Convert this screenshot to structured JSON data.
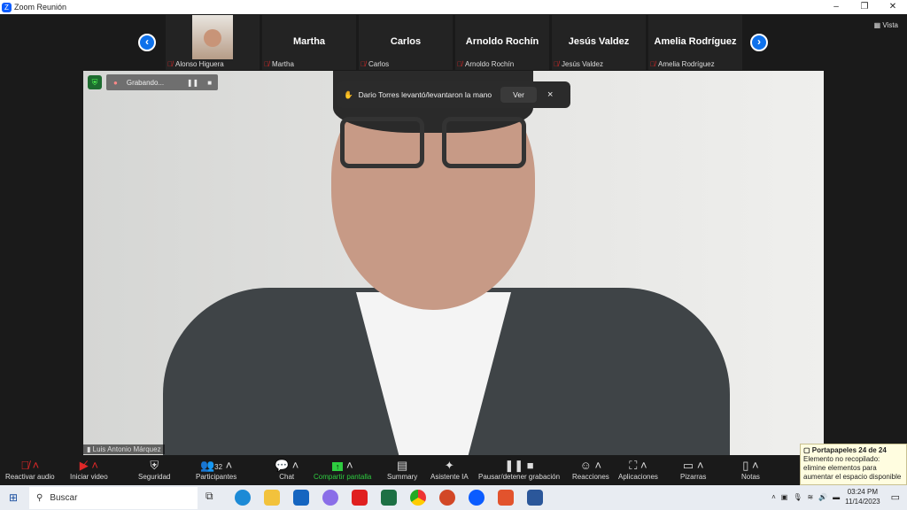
{
  "window": {
    "title": "Zoom Reunión",
    "minimize": "–",
    "restore": "❐",
    "close": "✕"
  },
  "strip": {
    "view_label": "Vista",
    "prev": "‹",
    "next": "›",
    "tiles": [
      {
        "name": "",
        "label": "Alonso Higuera"
      },
      {
        "name": "Martha",
        "label": "Martha"
      },
      {
        "name": "Carlos",
        "label": "Carlos"
      },
      {
        "name": "Arnoldo Rochín",
        "label": "Arnoldo Rochín"
      },
      {
        "name": "Jesús Valdez",
        "label": "Jesús Valdez"
      },
      {
        "name": "Amelia Rodríguez",
        "label": "Amelia Rodríguez"
      }
    ]
  },
  "recording": {
    "label": "Grabando..."
  },
  "notification": {
    "text": "Dario Torres levantó/levantaron la mano",
    "view": "Ver",
    "close": "×"
  },
  "speaker": {
    "name": "Luis Antonio Márquez"
  },
  "toolbar": {
    "participant_count": "32",
    "items": [
      "Reactivar audio",
      "Iniciar video",
      "Seguridad",
      "Participantes",
      "Chat",
      "Compartir pantalla",
      "Summary",
      "Asistente IA",
      "Pausar/detener grabación",
      "Reacciones",
      "Aplicaciones",
      "Pizarras",
      "Notas"
    ]
  },
  "clipboard": {
    "title": "Portapapeles 24 de 24",
    "body": "Elemento no recopilado: elimine elementos para aumentar el espacio disponible"
  },
  "taskbar": {
    "search": "Buscar",
    "time": "03:24 PM",
    "date": "11/14/2023"
  },
  "colors": {
    "accent": "#0e71eb",
    "share": "#2ecc40",
    "muted": "#e02828"
  }
}
